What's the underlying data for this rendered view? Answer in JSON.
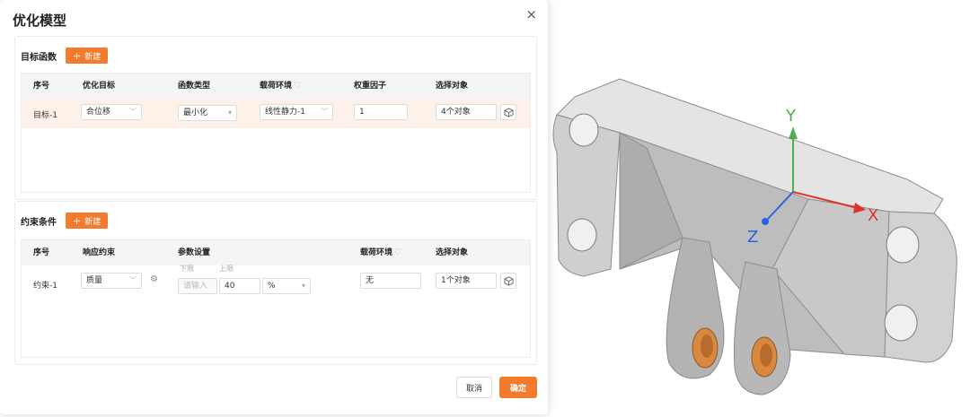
{
  "dialog": {
    "title": "优化模型",
    "close_glyph": "×",
    "cancel_label": "取消",
    "confirm_label": "确定"
  },
  "objectives": {
    "title": "目标函数",
    "new_label": "新建",
    "columns": [
      "序号",
      "优化目标",
      "函数类型",
      "载荷环境",
      "权重因子",
      "选择对象"
    ],
    "rows": [
      {
        "index": "目标-1",
        "target": "合位移",
        "func_type": "最小化",
        "load_env": "线性静力-1",
        "weight": "1",
        "objects": "4个对象"
      }
    ]
  },
  "constraints": {
    "title": "约束条件",
    "new_label": "新建",
    "columns": [
      "序号",
      "响应约束",
      "参数设置",
      "载荷环境",
      "选择对象"
    ],
    "lower_label": "下限",
    "upper_label": "上限",
    "rows": [
      {
        "index": "约束-1",
        "response": "质量",
        "lower_placeholder": "请输入",
        "upper_value": "40",
        "unit": "%",
        "load_env": "无",
        "objects": "1个对象"
      }
    ]
  },
  "viewport": {
    "axes": {
      "x": "X",
      "y": "Y",
      "z": "Z"
    },
    "colors": {
      "x_axis": "#e0302a",
      "y_axis": "#4caf50",
      "z_axis": "#2a62e0",
      "accent": "#f27b2e",
      "bushing": "#d9893f"
    }
  }
}
